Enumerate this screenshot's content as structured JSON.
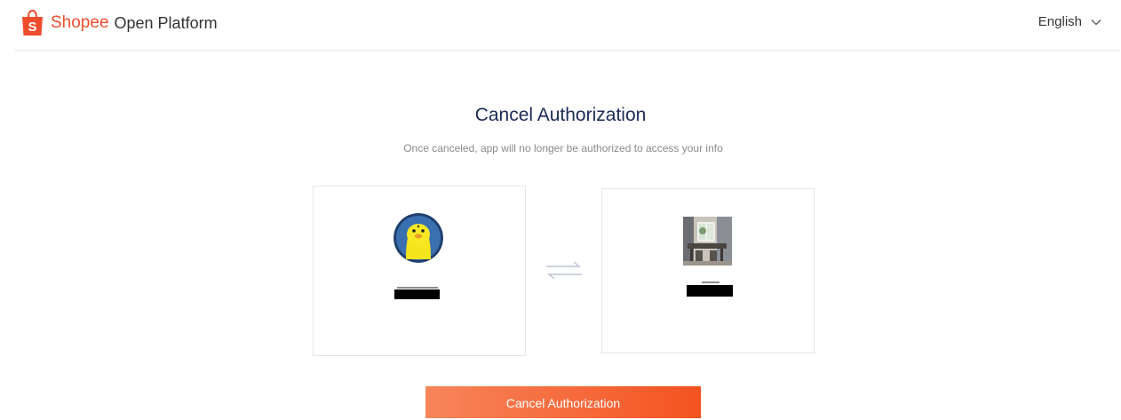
{
  "header": {
    "brand_name": "Shopee",
    "brand_sub": "Open Platform",
    "language": "English",
    "icons": {
      "logo": "shopee-bag-icon",
      "language_toggle": "chevron-down-icon"
    }
  },
  "main": {
    "title": "Cancel Authorization",
    "subtitle": "Once canceled, app will no longer be authorized to access your info",
    "swap_icon": "swap-arrows-icon",
    "cancel_button_label": "Cancel Authorization"
  },
  "colors": {
    "brand": "#ee4d2d",
    "title": "#1b2b55",
    "button_start": "#f7855a",
    "button_end": "#f4531f"
  }
}
